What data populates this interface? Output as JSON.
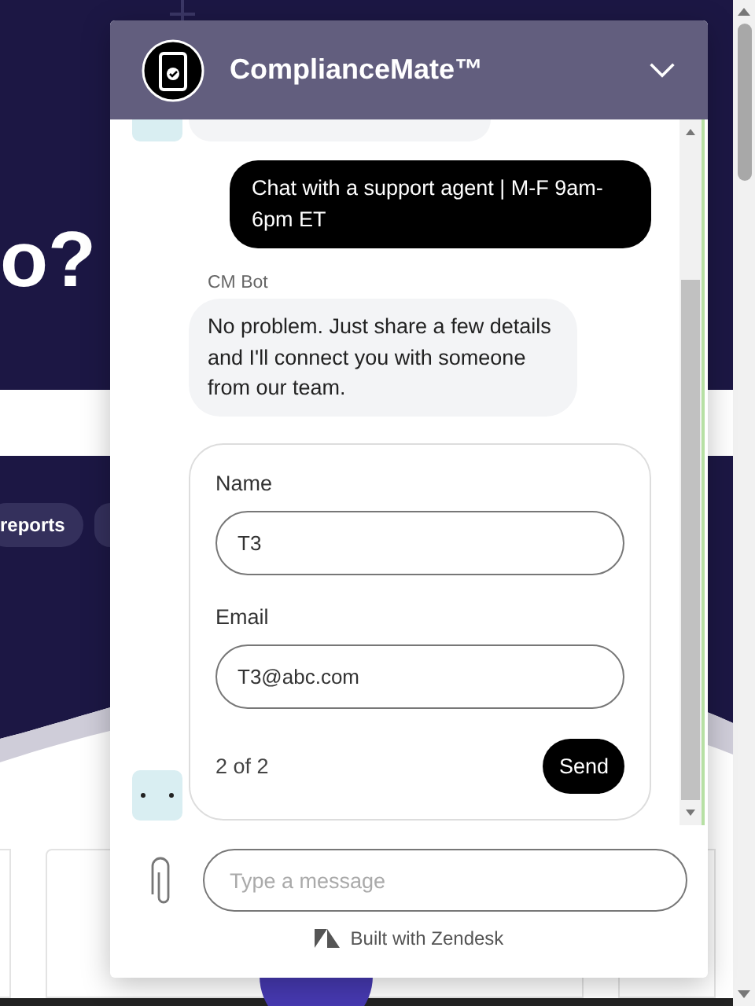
{
  "page": {
    "heading_fragment": "o?",
    "chip": "reports"
  },
  "chat": {
    "title": "ComplianceMate™",
    "messages": [
      {
        "kind": "user",
        "text": "Chat with a support agent | M-F 9am-6pm ET"
      },
      {
        "kind": "bot",
        "sender": "CM Bot",
        "text": "No problem. Just share a few details and I'll connect you with someone from our team."
      }
    ],
    "form": {
      "fields": [
        {
          "label": "Name",
          "value": "T3"
        },
        {
          "label": "Email",
          "value": "T3@abc.com"
        }
      ],
      "step": "2 of 2",
      "submit": "Send"
    },
    "composer": {
      "placeholder": "Type a message"
    },
    "footer": "Built with Zendesk"
  }
}
